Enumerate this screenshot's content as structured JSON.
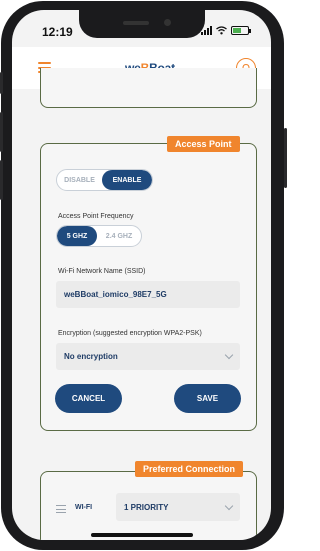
{
  "status_bar": {
    "time": "12:19"
  },
  "header": {
    "logo_prefix": "we",
    "logo_mid": "B",
    "logo_suffix": "Boat"
  },
  "access_point": {
    "badge": "Access Point",
    "mode_options": [
      "DISABLE",
      "ENABLE"
    ],
    "mode_selected": "ENABLE",
    "frequency_label": "Access Point Frequency",
    "frequency_options": [
      "5 GHZ",
      "2.4 GHZ"
    ],
    "frequency_selected": "5 GHZ",
    "ssid_label": "Wi-Fi Network Name (SSID)",
    "ssid_value": "weBBoat_iomico_98E7_5G",
    "encryption_label": "Encryption (suggested encryption WPA2-PSK)",
    "encryption_value": "No encryption",
    "cancel_label": "CANCEL",
    "save_label": "SAVE"
  },
  "preferred_connection": {
    "badge": "Preferred Connection",
    "row_label": "WI-FI",
    "priority_value": "1 PRIORITY"
  },
  "colors": {
    "accent": "#f0852d",
    "primary": "#1f4a7e",
    "card_border": "#5a6b45"
  }
}
